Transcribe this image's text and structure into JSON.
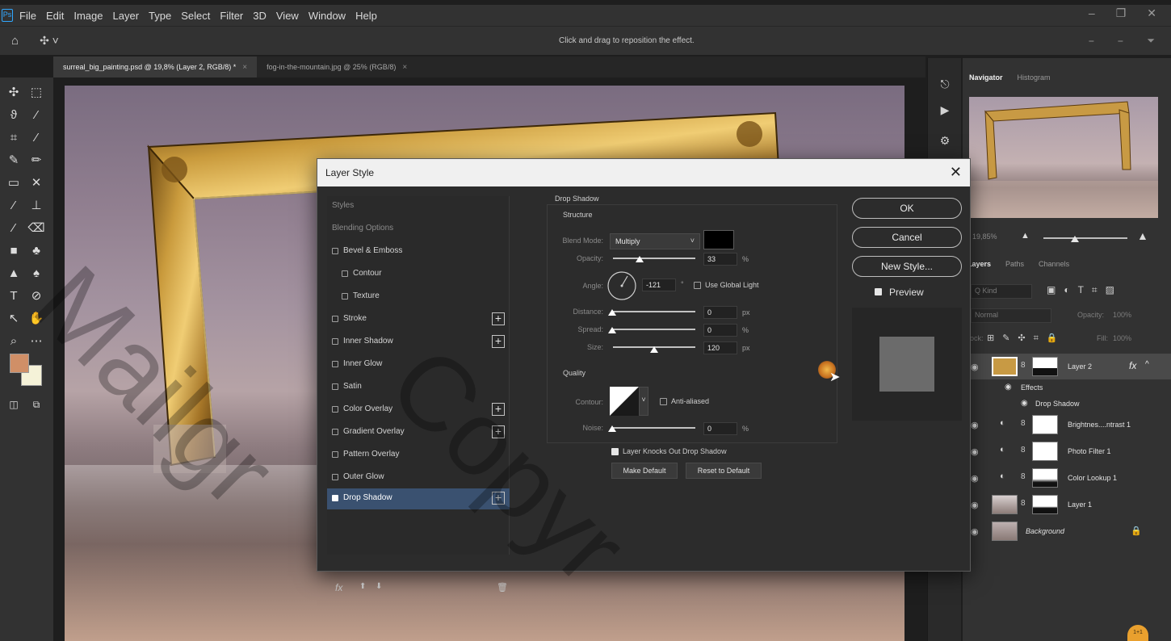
{
  "menubar": {
    "logo": "Ps",
    "items": [
      "File",
      "Edit",
      "Image",
      "Layer",
      "Type",
      "Select",
      "Filter",
      "3D",
      "View",
      "Window",
      "Help"
    ],
    "controls": [
      "–",
      "❐",
      "✕"
    ]
  },
  "options": {
    "hint": "Click and drag to reposition the effect."
  },
  "tabs": [
    {
      "label": "surreal_big_painting.psd @ 19,8% (Layer 2, RGB/8) *",
      "close": "×"
    },
    {
      "label": "fog-in-the-mountain.jpg @ 25% (RGB/8)",
      "close": "×"
    }
  ],
  "navigator": {
    "tabs": [
      "Navigator",
      "Histogram"
    ],
    "zoom": "19,85%"
  },
  "layers_panel": {
    "tabs": [
      "Layers",
      "Paths",
      "Channels"
    ],
    "filter_placeholder": "Q Kind",
    "blend_mode": "Normal",
    "opacity_label": "Opacity:",
    "opacity_value": "100%",
    "lock_label": "Lock:",
    "fill_label": "Fill:",
    "fill_value": "100%",
    "layers": [
      {
        "name": "Layer 2",
        "fx": "fx",
        "selected": true
      },
      {
        "name": "Effects",
        "sub": true
      },
      {
        "name": "Drop Shadow",
        "sub": true
      },
      {
        "name": "Brightnes....ntrast 1"
      },
      {
        "name": "Photo Filter 1"
      },
      {
        "name": "Color Lookup 1"
      },
      {
        "name": "Layer 1"
      },
      {
        "name": "Background"
      }
    ]
  },
  "dialog": {
    "title": "Layer Style",
    "close": "✕",
    "styles": [
      {
        "label": "Styles",
        "dim": true
      },
      {
        "label": "Blending Options",
        "dim": true
      },
      {
        "label": "Bevel & Emboss",
        "checked": false
      },
      {
        "label": "Contour",
        "checked": false,
        "indent": true
      },
      {
        "label": "Texture",
        "checked": false,
        "indent": true
      },
      {
        "label": "Stroke",
        "checked": false,
        "plus": true
      },
      {
        "label": "Inner Shadow",
        "checked": false,
        "plus": true
      },
      {
        "label": "Inner Glow",
        "checked": false
      },
      {
        "label": "Satin",
        "checked": false
      },
      {
        "label": "Color Overlay",
        "checked": false,
        "plus": true
      },
      {
        "label": "Gradient Overlay",
        "checked": false,
        "plus": true
      },
      {
        "label": "Pattern Overlay",
        "checked": false
      },
      {
        "label": "Outer Glow",
        "checked": false
      },
      {
        "label": "Drop Shadow",
        "checked": true,
        "plus": true,
        "selected": true
      }
    ],
    "footer": {
      "fx": "fx",
      "trash": "🗑"
    },
    "drop_shadow": {
      "section": "Drop Shadow",
      "structure": "Structure",
      "blend_mode_label": "Blend Mode:",
      "blend_mode": "Multiply",
      "shadow_color": "#000000",
      "opacity_label": "Opacity:",
      "opacity": "33",
      "opacity_unit": "%",
      "angle_label": "Angle:",
      "angle": "-121",
      "angle_unit": "°",
      "global_light_label": "Use Global Light",
      "distance_label": "Distance:",
      "distance": "0",
      "distance_unit": "px",
      "spread_label": "Spread:",
      "spread": "0",
      "spread_unit": "%",
      "size_label": "Size:",
      "size": "120",
      "size_unit": "px",
      "quality": "Quality",
      "contour_label": "Contour:",
      "anti_aliased_label": "Anti-aliased",
      "noise_label": "Noise:",
      "noise": "0",
      "noise_unit": "%",
      "knockout_label": "Layer Knocks Out Drop Shadow",
      "make_default": "Make Default",
      "reset_default": "Reset to Default"
    },
    "buttons": {
      "ok": "OK",
      "cancel": "Cancel",
      "new_style": "New Style...",
      "preview": "Preview"
    }
  },
  "watermark": [
    "Mailgr",
    "Copyr"
  ],
  "badge": "1+1"
}
